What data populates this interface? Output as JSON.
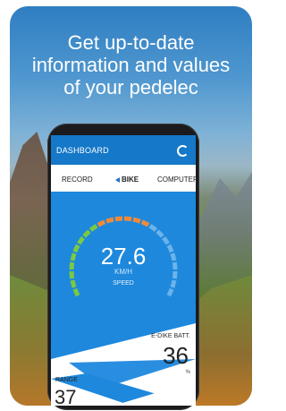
{
  "headline": {
    "line1": "Get up-to-date",
    "line2": "information and values",
    "line3": "of your pedelec"
  },
  "app": {
    "title": "DASHBOARD",
    "refresh_icon": "refresh-icon"
  },
  "tabs": [
    {
      "label": "RECORD",
      "active": false
    },
    {
      "label": "BIKE",
      "active": true
    },
    {
      "label": "COMPUTERS",
      "active": false
    }
  ],
  "speed": {
    "value": "27.6",
    "unit": "KM/H",
    "label": "SPEED",
    "gauge_fraction": 0.62
  },
  "ebike_battery": {
    "label": "E-DIKE BATT.",
    "value": "36",
    "unit": "%"
  },
  "range": {
    "label": "RANGE",
    "value": "37"
  },
  "colors": {
    "screen_blue": "#1e88dc",
    "header_blue": "#1578c8",
    "gauge_green": "#7ac943",
    "gauge_orange": "#f08a3a",
    "gauge_track": "#6bb3ea"
  }
}
